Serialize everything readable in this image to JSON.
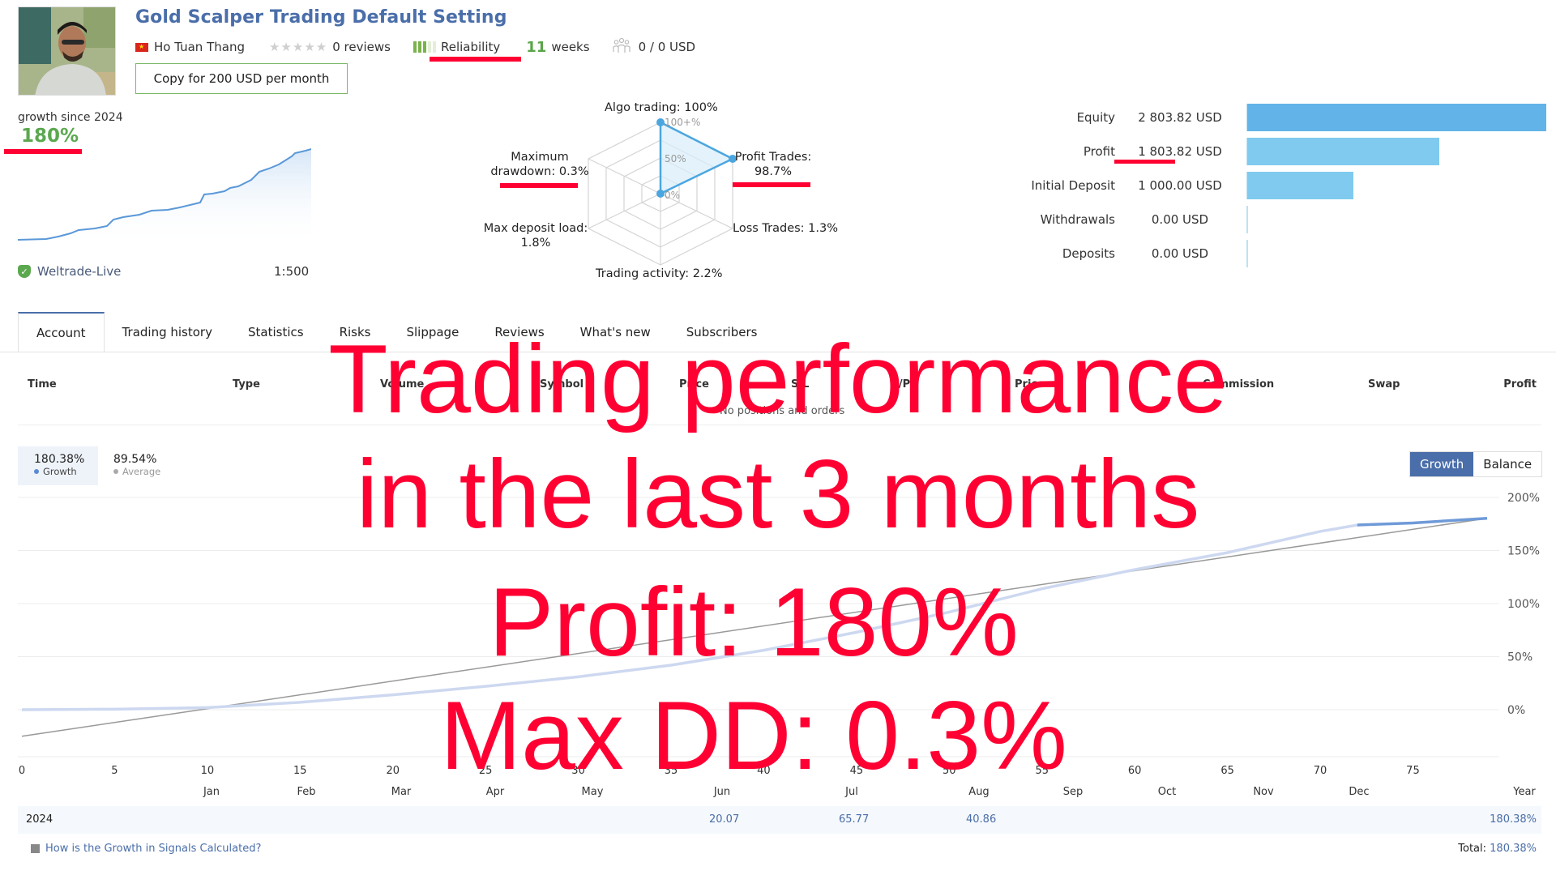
{
  "header": {
    "title": "Gold Scalper Trading Default Setting",
    "author": "Ho Tuan Thang",
    "reviews": "0 reviews",
    "reliability_label": "Reliability",
    "reliability_level": "3 of 5",
    "weeks_num": "11",
    "weeks_label": "weeks",
    "subscribers": "0 / 0 USD",
    "copy_button": "Copy for 200 USD per month"
  },
  "summary": {
    "growth_label": "growth since 2024",
    "growth_value": "180%",
    "broker": "Weltrade-Live",
    "leverage": "1:500"
  },
  "radar": {
    "algo": "Algo trading: 100%",
    "profit_trades_1": "Profit Trades:",
    "profit_trades_2": "98.7%",
    "loss_trades": "Loss Trades: 1.3%",
    "activity": "Trading activity: 2.2%",
    "deposit_load_1": "Max deposit load:",
    "deposit_load_2": "1.8%",
    "drawdown_1": "Maximum",
    "drawdown_2": "drawdown: 0.3%",
    "scale_100": "100+%",
    "scale_50": "50%",
    "scale_0": "0%"
  },
  "equity": {
    "rows": [
      {
        "label": "Equity",
        "value": "2 803.82 USD",
        "amount": 2803.82
      },
      {
        "label": "Profit",
        "value": "1 803.82 USD",
        "amount": 1803.82
      },
      {
        "label": "Initial Deposit",
        "value": "1 000.00 USD",
        "amount": 1000.0
      },
      {
        "label": "Withdrawals",
        "value": "0.00 USD",
        "amount": 0
      },
      {
        "label": "Deposits",
        "value": "0.00 USD",
        "amount": 0
      }
    ]
  },
  "tabs": [
    "Account",
    "Trading history",
    "Statistics",
    "Risks",
    "Slippage",
    "Reviews",
    "What's new",
    "Subscribers"
  ],
  "positions": {
    "columns": [
      "Time",
      "Type",
      "Volume",
      "Symbol",
      "Price",
      "S/L",
      "T/P",
      "Price",
      "Commission",
      "Swap",
      "Profit"
    ],
    "empty": "No positions and orders"
  },
  "growth_chart": {
    "growth_value": "180.38%",
    "growth_label": "Growth",
    "avg_value": "89.54%",
    "avg_label": "Average",
    "toggle_growth": "Growth",
    "toggle_balance": "Balance",
    "months": [
      "Jan",
      "Feb",
      "Mar",
      "Apr",
      "May",
      "Jun",
      "Jul",
      "Aug",
      "Sep",
      "Oct",
      "Nov",
      "Dec",
      "Year"
    ],
    "year": "2024",
    "month_values": {
      "Jun": "20.07",
      "Jul": "65.77",
      "Aug": "40.86"
    },
    "year_total": "180.38%",
    "faq": "How is the Growth in Signals Calculated?",
    "total_label": "Total:",
    "total_value": "180.38%"
  },
  "chart_data": {
    "type": "line",
    "title": "",
    "xlabel": "",
    "ylabel": "",
    "x_ticks": [
      0,
      5,
      10,
      15,
      20,
      25,
      30,
      35,
      40,
      45,
      50,
      55,
      60,
      65,
      70,
      75
    ],
    "y_ticks": [
      "0%",
      "50%",
      "100%",
      "150%",
      "200%"
    ],
    "xlim": [
      0,
      80
    ],
    "ylim": [
      -25,
      210
    ],
    "series": [
      {
        "name": "Growth",
        "x": [
          0,
          5,
          10,
          15,
          20,
          25,
          30,
          35,
          40,
          45,
          50,
          55,
          60,
          65,
          70,
          72,
          75,
          79
        ],
        "values": [
          0,
          0.5,
          2,
          7,
          14,
          22,
          31,
          42,
          56,
          73,
          92,
          114,
          132,
          148,
          168,
          174,
          176,
          180.38
        ]
      },
      {
        "name": "Average",
        "x": [
          0,
          79
        ],
        "values": [
          -25,
          180.38
        ]
      }
    ],
    "grid": true,
    "legend": "top-left"
  },
  "overlay": {
    "line1": "Trading performance",
    "line2": "in the last 3 months",
    "line3": "Profit: 180%",
    "line4": "Max DD: 0.3%"
  }
}
